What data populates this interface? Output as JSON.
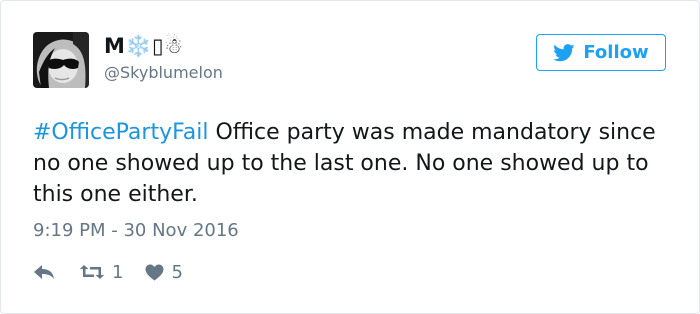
{
  "user": {
    "display_name": "M❄️▯☃",
    "handle": "@Skyblumelon"
  },
  "follow_button": {
    "label": "Follow",
    "icon": "twitter-bird-icon",
    "color": "#1da1f2"
  },
  "tweet": {
    "hashtag": "#OfficePartyFail",
    "body": " Office party was made mandatory since no one showed up to the last one. No one showed up to this one either.",
    "timestamp": "9:19 PM - 30 Nov 2016"
  },
  "actions": {
    "reply_icon": "reply-icon",
    "retweet_icon": "retweet-icon",
    "retweet_count": "1",
    "like_icon": "heart-icon",
    "like_count": "5"
  },
  "colors": {
    "link": "#1b95e0",
    "muted": "#657786",
    "text": "#14171a"
  }
}
